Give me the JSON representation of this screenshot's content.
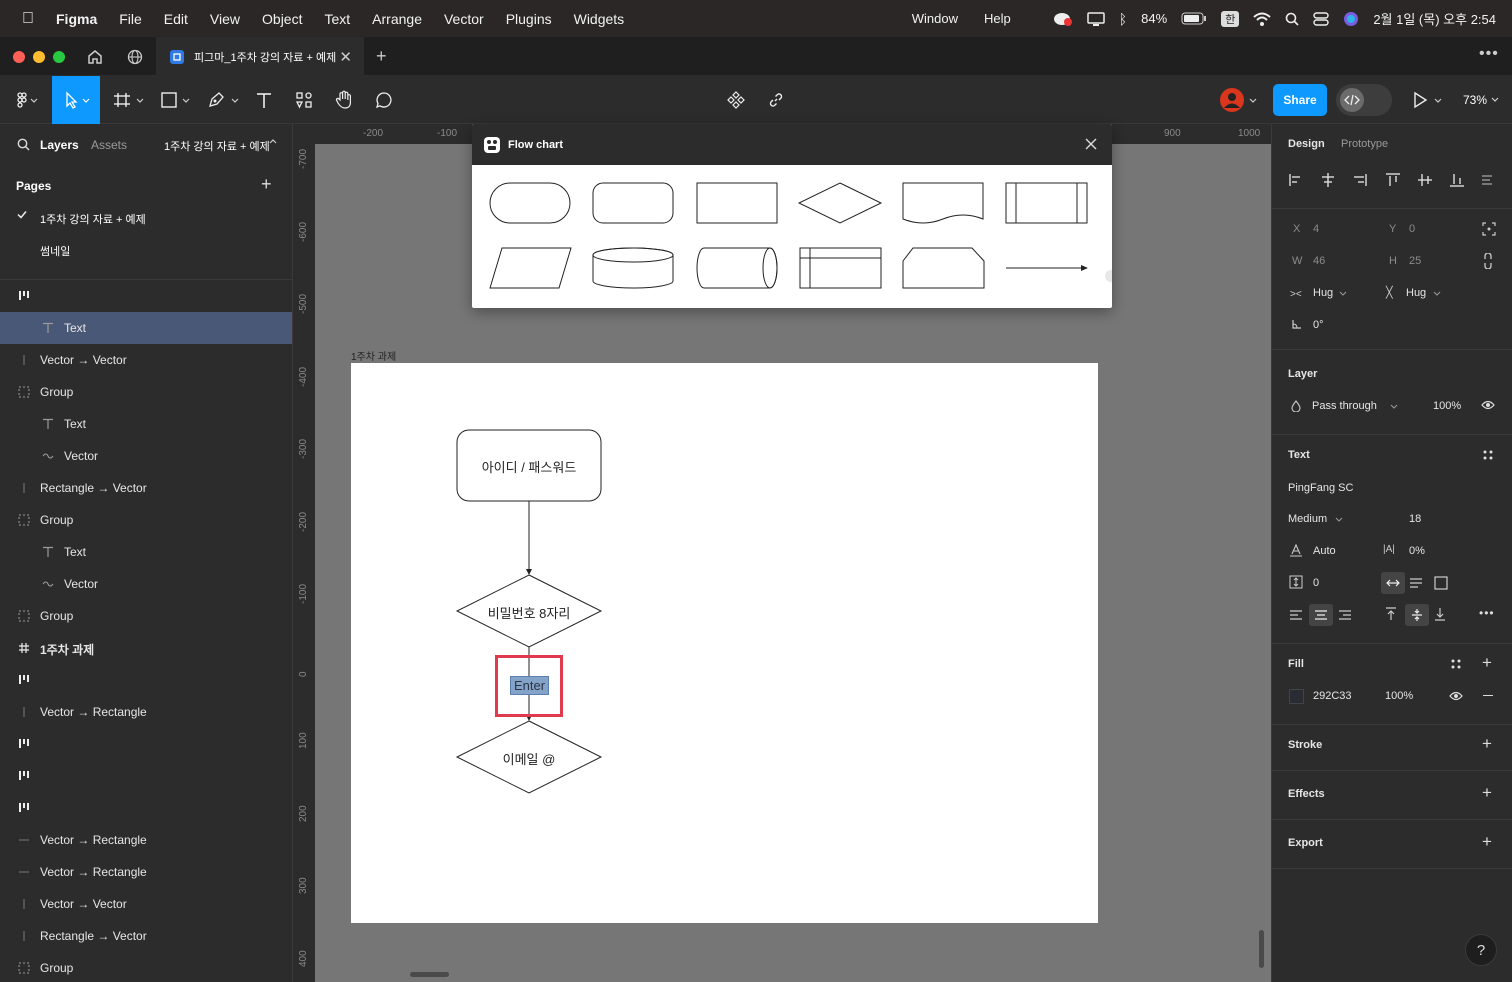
{
  "menubar": {
    "app": "Figma",
    "items": [
      "File",
      "Edit",
      "View",
      "Object",
      "Text",
      "Arrange",
      "Vector",
      "Plugins",
      "Widgets"
    ],
    "right_items": [
      "Window",
      "Help"
    ],
    "battery": "84%",
    "input_method": "한",
    "clock": "2월 1일 (목) 오후 2:54"
  },
  "tabbar": {
    "tab_title": "피그마_1주차 강의 자료 + 예제"
  },
  "toolbar": {
    "share_label": "Share",
    "zoom": "73%"
  },
  "left_panel": {
    "tab_layers": "Layers",
    "tab_assets": "Assets",
    "page_selector": "1주차 강의 자료 + 예제",
    "pages_title": "Pages",
    "pages": [
      "1주차 강의 자료 + 예제",
      "썸네일"
    ],
    "layers": [
      {
        "label": "",
        "icon": "component-set-icon"
      },
      {
        "label": "Text",
        "icon": "text-icon"
      },
      {
        "label": "Vector → Vector",
        "icon": "line-icon"
      },
      {
        "label": "Group",
        "icon": "group-icon"
      },
      {
        "label": "Text",
        "icon": "text-icon"
      },
      {
        "label": "Vector",
        "icon": "vector-icon"
      },
      {
        "label": "Rectangle → Vector",
        "icon": "line-icon"
      },
      {
        "label": "Group",
        "icon": "group-icon"
      },
      {
        "label": "Text",
        "icon": "text-icon"
      },
      {
        "label": "Vector",
        "icon": "vector-icon"
      },
      {
        "label": "Group",
        "icon": "group-icon"
      },
      {
        "label": "1주차 과제",
        "icon": "frame-icon"
      },
      {
        "label": "",
        "icon": "component-set-icon"
      },
      {
        "label": "Vector → Rectangle",
        "icon": "line-icon"
      },
      {
        "label": "",
        "icon": "component-set-icon"
      },
      {
        "label": "",
        "icon": "component-set-icon"
      },
      {
        "label": "",
        "icon": "component-set-icon"
      },
      {
        "label": "Vector → Rectangle",
        "icon": "hline-icon"
      },
      {
        "label": "Vector → Rectangle",
        "icon": "hline-icon"
      },
      {
        "label": "Vector → Vector",
        "icon": "line-icon"
      },
      {
        "label": "Rectangle → Vector",
        "icon": "line-icon"
      },
      {
        "label": "Group",
        "icon": "group-icon"
      }
    ]
  },
  "canvas": {
    "ruler_top": [
      "-200",
      "-100",
      "900",
      "1000"
    ],
    "ruler_left": [
      "-700",
      "-600",
      "-500",
      "-400",
      "-300",
      "-200",
      "-100",
      "0",
      "100",
      "200",
      "300",
      "400"
    ],
    "frame_label": "1주차 과제",
    "node_start": "아이디 / 패스워드",
    "node_decision1": "비밀번호 8자리",
    "node_selected": "Enter",
    "node_decision2": "이메일 @"
  },
  "plugin": {
    "title": "Flow chart"
  },
  "right_panel": {
    "tab_design": "Design",
    "tab_prototype": "Prototype",
    "x_label": "X",
    "x_value": "4",
    "y_label": "Y",
    "y_value": "0",
    "w_label": "W",
    "w_value": "46",
    "h_label": "H",
    "h_value": "25",
    "hug_w": "Hug",
    "hug_h": "Hug",
    "rotation": "0°",
    "layer_title": "Layer",
    "blend": "Pass through",
    "opacity": "100%",
    "text_title": "Text",
    "font_family": "PingFang SC",
    "font_weight": "Medium",
    "font_size": "18",
    "line_height": "Auto",
    "letter_spacing": "0%",
    "paragraph_spacing": "0",
    "fill_title": "Fill",
    "fill_hex": "292C33",
    "fill_opacity": "100%",
    "stroke_title": "Stroke",
    "effects_title": "Effects",
    "export_title": "Export",
    "help": "?"
  },
  "colors": {
    "accent": "#0d99ff",
    "selection_row": "#4a5877",
    "highlight_box": "#e03a4e",
    "fill_swatch": "#292c33"
  }
}
